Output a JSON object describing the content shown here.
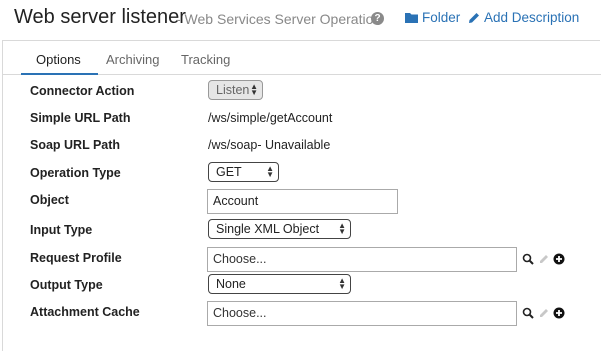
{
  "header": {
    "title": "Web server listener",
    "subtitle": "- Web Services Server Operation",
    "help_icon": "question-circle-icon",
    "folder_link": "Folder",
    "folder_icon": "folder-icon",
    "add_description_link": "Add Description",
    "add_description_icon": "pencil-icon",
    "link_color": "#2a72b5"
  },
  "tabs": [
    {
      "label": "Options",
      "active": true
    },
    {
      "label": "Archiving",
      "active": false
    },
    {
      "label": "Tracking",
      "active": false
    }
  ],
  "form": {
    "connector_action": {
      "label": "Connector Action",
      "value": "Listen",
      "disabled": true
    },
    "simple_url_path": {
      "label": "Simple URL Path",
      "value": "/ws/simple/getAccount"
    },
    "soap_url_path": {
      "label": "Soap URL Path",
      "value": "/ws/soap- Unavailable"
    },
    "operation_type": {
      "label": "Operation Type",
      "value": "GET"
    },
    "object": {
      "label": "Object",
      "value": "Account"
    },
    "input_type": {
      "label": "Input Type",
      "value": "Single XML Object"
    },
    "request_profile": {
      "label": "Request Profile",
      "value": "Choose..."
    },
    "output_type": {
      "label": "Output Type",
      "value": "None"
    },
    "attachment_cache": {
      "label": "Attachment Cache",
      "value": "Choose..."
    }
  },
  "icons": {
    "search": "magnifier-icon",
    "edit": "edit-icon",
    "add": "plus-circle-icon"
  }
}
